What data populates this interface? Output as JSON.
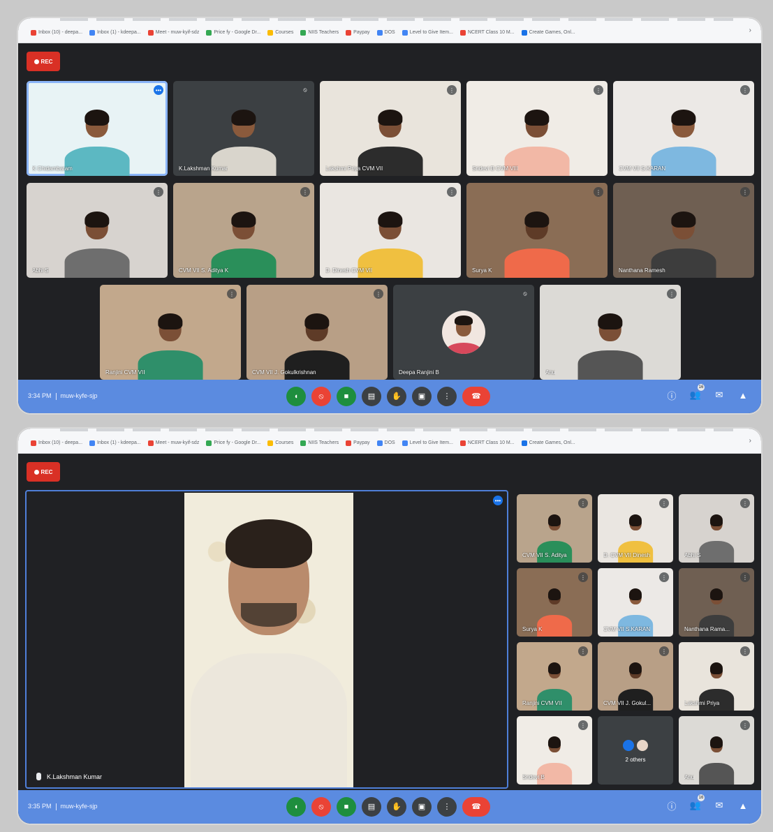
{
  "colors": {
    "page_bg": "#c9c9c9",
    "meet_bg": "#202124",
    "control_bar": "#5b8be0",
    "rec_red": "#d93025",
    "mic_green": "#1e8e3e",
    "end_call_red": "#ea4335",
    "active_speaker_outline": "#8ab4f8"
  },
  "bookmarks": [
    {
      "label": "Inbox (10) - deepa...",
      "icon_color": "#ea4335"
    },
    {
      "label": "Inbox (1) - kdeepa...",
      "icon_color": "#4285f4"
    },
    {
      "label": "Meet - muw-kyif-sdz",
      "icon_color": "#ea4335"
    },
    {
      "label": "Price fy - Google Dr...",
      "icon_color": "#34a853"
    },
    {
      "label": "Courses",
      "icon_color": "#fbbc04"
    },
    {
      "label": "NIIS Teachers",
      "icon_color": "#34a853"
    },
    {
      "label": "Paypay",
      "icon_color": "#ea4335"
    },
    {
      "label": "DOS",
      "icon_color": "#4285f4"
    },
    {
      "label": "Level to Give Item...",
      "icon_color": "#4285f4"
    },
    {
      "label": "NCERT Class 10 M...",
      "icon_color": "#ea4335"
    },
    {
      "label": "Create Games, Onl...",
      "icon_color": "#1a73e8"
    }
  ],
  "rec_label": "REC",
  "shot1": {
    "time": "3:34 PM",
    "meeting_code": "muw-kyfe-sjp",
    "tiles": [
      {
        "name": "K Chidambaram",
        "icon": "speaking",
        "bg": "#e8f3f5",
        "skin": "#8a5a3c",
        "shirt": "#5cb8c2",
        "active": true
      },
      {
        "name": "K.Lakshman Kumar",
        "icon": "muted",
        "bg": "#3c4043",
        "skin": "#8a5a3c",
        "shirt": "#d9d5cc",
        "active": false
      },
      {
        "name": "Lakshmi Priya CVM VII",
        "icon": "dot",
        "bg": "#e9e4dc",
        "skin": "#7b4f36",
        "shirt": "#2c2c2c",
        "active": false
      },
      {
        "name": "Sridevi B CVM VIII",
        "icon": "dot",
        "bg": "#f0ece6",
        "skin": "#7b4f36",
        "shirt": "#f2b8a6",
        "active": false
      },
      {
        "name": "CVM VII S.KARAN",
        "icon": "dot",
        "bg": "#ece9e6",
        "skin": "#8a5a3c",
        "shirt": "#7eb8e0",
        "active": false
      },
      {
        "name": "Abhi S",
        "icon": "dot",
        "bg": "#d7d3cf",
        "skin": "#7b4f36",
        "shirt": "#6e6e6e",
        "active": false
      },
      {
        "name": "CVM VII S. Aditya K",
        "icon": "dot",
        "bg": "#b9a48c",
        "skin": "#7b4f36",
        "shirt": "#2a8f5a",
        "active": false
      },
      {
        "name": "D. Dinesh CVM VII",
        "icon": "dot",
        "bg": "#eae6e1",
        "skin": "#7b4f36",
        "shirt": "#f0c040",
        "active": false
      },
      {
        "name": "Surya K",
        "icon": "dot",
        "bg": "#8a6d55",
        "skin": "#5e3b27",
        "shirt": "#ef6a4a",
        "active": false
      },
      {
        "name": "Nanthana Ramesh",
        "icon": "dot",
        "bg": "#6f5f52",
        "skin": "#7b4f36",
        "shirt": "#3d3d3d",
        "active": false
      },
      {
        "name": "Ranjini CVM VII",
        "icon": "dot",
        "bg": "#c2a88c",
        "skin": "#7b4f36",
        "shirt": "#2f8f6a",
        "active": false
      },
      {
        "name": "CVM VII J. Gokulkrishnan",
        "icon": "dot",
        "bg": "#b89f86",
        "skin": "#5e3b27",
        "shirt": "#1f1f1f",
        "active": false
      },
      {
        "name": "Deepa Ranjini B",
        "icon": "muted",
        "bg": "#3c4043",
        "avatar": true,
        "active": false
      },
      {
        "name": "Anu",
        "icon": "dot",
        "bg": "#dcdad6",
        "skin": "#7b4f36",
        "shirt": "#555555",
        "active": false
      }
    ]
  },
  "shot2": {
    "time": "3:35 PM",
    "meeting_code": "muw-kyfe-sjp",
    "spotlight_name": "K.Lakshman Kumar",
    "tiles": [
      {
        "name": "CVM VII S. Aditya",
        "icon": "dot",
        "bg": "#b9a48c",
        "skin": "#7b4f36",
        "shirt": "#2a8f5a"
      },
      {
        "name": "D. CVM VII Dinesh",
        "icon": "dot",
        "bg": "#eae6e1",
        "skin": "#7b4f36",
        "shirt": "#f0c040"
      },
      {
        "name": "Abhi S",
        "icon": "dot",
        "bg": "#d7d3cf",
        "skin": "#7b4f36",
        "shirt": "#6e6e6e"
      },
      {
        "name": "Surya K",
        "icon": "dot",
        "bg": "#8a6d55",
        "skin": "#5e3b27",
        "shirt": "#ef6a4a"
      },
      {
        "name": "CVM VII S.KARAN",
        "icon": "dot",
        "bg": "#ece9e6",
        "skin": "#8a5a3c",
        "shirt": "#7eb8e0"
      },
      {
        "name": "Nanthana Rama...",
        "icon": "dot",
        "bg": "#6f5f52",
        "skin": "#7b4f36",
        "shirt": "#3d3d3d"
      },
      {
        "name": "Ranjini CVM VII",
        "icon": "dot",
        "bg": "#c2a88c",
        "skin": "#7b4f36",
        "shirt": "#2f8f6a"
      },
      {
        "name": "CVM VII J. Gokul...",
        "icon": "dot",
        "bg": "#b89f86",
        "skin": "#5e3b27",
        "shirt": "#1f1f1f"
      },
      {
        "name": "Lakshmi Priya",
        "icon": "dot",
        "bg": "#e9e4dc",
        "skin": "#7b4f36",
        "shirt": "#2c2c2c"
      },
      {
        "name": "Sridevi B",
        "icon": "dot",
        "bg": "#f0ece6",
        "skin": "#7b4f36",
        "shirt": "#f2b8a6"
      },
      {
        "name": "2 others",
        "icon": "",
        "bg": "#3c4043",
        "others": true
      },
      {
        "name": "Anu",
        "icon": "dot",
        "bg": "#dcdad6",
        "skin": "#7b4f36",
        "shirt": "#555555"
      }
    ]
  },
  "controls": {
    "buttons": [
      {
        "name": "mic-button",
        "icon": "microphone-icon",
        "glyph": "◖",
        "style": "green"
      },
      {
        "name": "mic-off-button",
        "icon": "microphone-off-icon",
        "glyph": "⦸",
        "style": "red"
      },
      {
        "name": "camera-button",
        "icon": "camera-icon",
        "glyph": "■",
        "style": "green"
      },
      {
        "name": "captions-button",
        "icon": "captions-icon",
        "glyph": "▤",
        "style": "gray"
      },
      {
        "name": "raise-hand-button",
        "icon": "hand-icon",
        "glyph": "✋",
        "style": "gray"
      },
      {
        "name": "present-button",
        "icon": "present-icon",
        "glyph": "▣",
        "style": "gray"
      },
      {
        "name": "more-options-button",
        "icon": "more-vert-icon",
        "glyph": "⋮",
        "style": "gray"
      },
      {
        "name": "end-call-button",
        "icon": "phone-hangup-icon",
        "glyph": "☎",
        "style": "end"
      }
    ],
    "side": [
      {
        "name": "info-button",
        "icon": "info-icon",
        "glyph": "ⓘ",
        "badge": ""
      },
      {
        "name": "people-button",
        "icon": "people-icon",
        "glyph": "👥",
        "badge": "16"
      },
      {
        "name": "chat-button",
        "icon": "chat-icon",
        "glyph": "✉",
        "badge": ""
      },
      {
        "name": "activities-button",
        "icon": "activities-icon",
        "glyph": "▲",
        "badge": ""
      }
    ]
  }
}
